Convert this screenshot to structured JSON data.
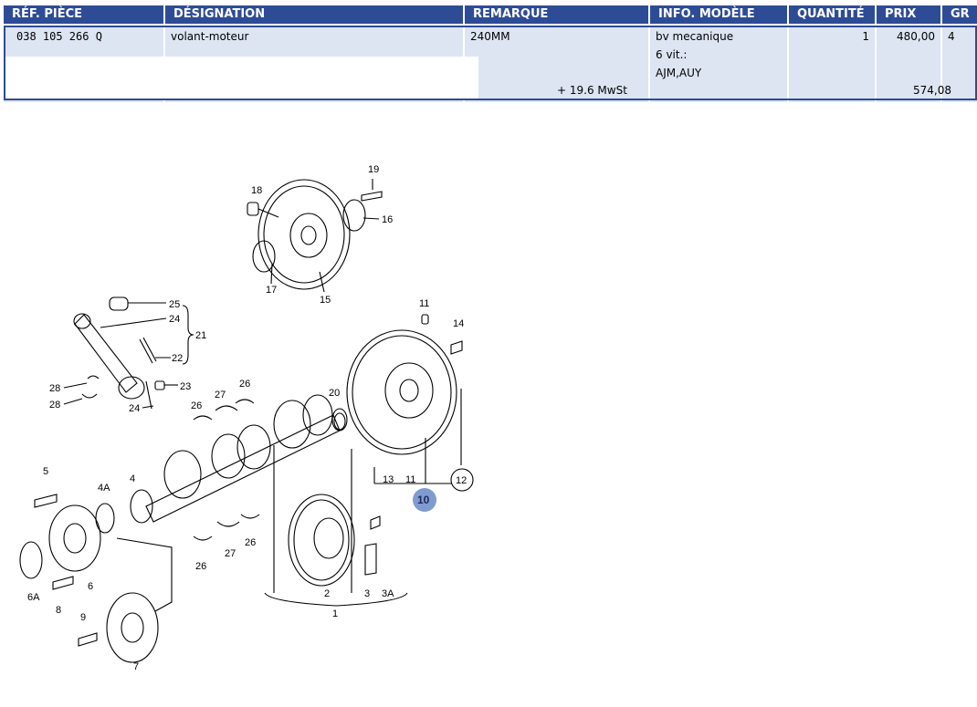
{
  "table": {
    "headers": {
      "ref": "RÉF. PIÈCE",
      "designation": "DÉSIGNATION",
      "remarque": "REMARQUE",
      "info": "INFO. MODÈLE",
      "quantite": "QUANTITÉ",
      "prix": "PRIX",
      "gr": "GR"
    },
    "row": {
      "ref": "038 105 266 Q",
      "designation": "volant-moteur",
      "remarque": "240MM",
      "info_lines": [
        "bv mecanique",
        "6 vit.:",
        "AJM,AUY"
      ],
      "quantite": "1",
      "prix": "480,00",
      "gr": "4",
      "tax_label": "+ 19.6 MwSt",
      "prix_ttc": "574,08"
    },
    "accent_color": "#2e4c95",
    "row_bg": "#dde5f3"
  },
  "diagram": {
    "part_labels": [
      "1",
      "2",
      "3",
      "3A",
      "4",
      "4A",
      "5",
      "6",
      "6A",
      "7",
      "8",
      "9",
      "10",
      "11",
      "11",
      "12",
      "13",
      "14",
      "15",
      "16",
      "17",
      "18",
      "19",
      "20",
      "21",
      "22",
      "23",
      "24",
      "24",
      "25",
      "26",
      "26",
      "26",
      "26",
      "27",
      "27",
      "28",
      "28"
    ],
    "highlighted_label": "10",
    "highlight_color": "#7f9bd0"
  }
}
